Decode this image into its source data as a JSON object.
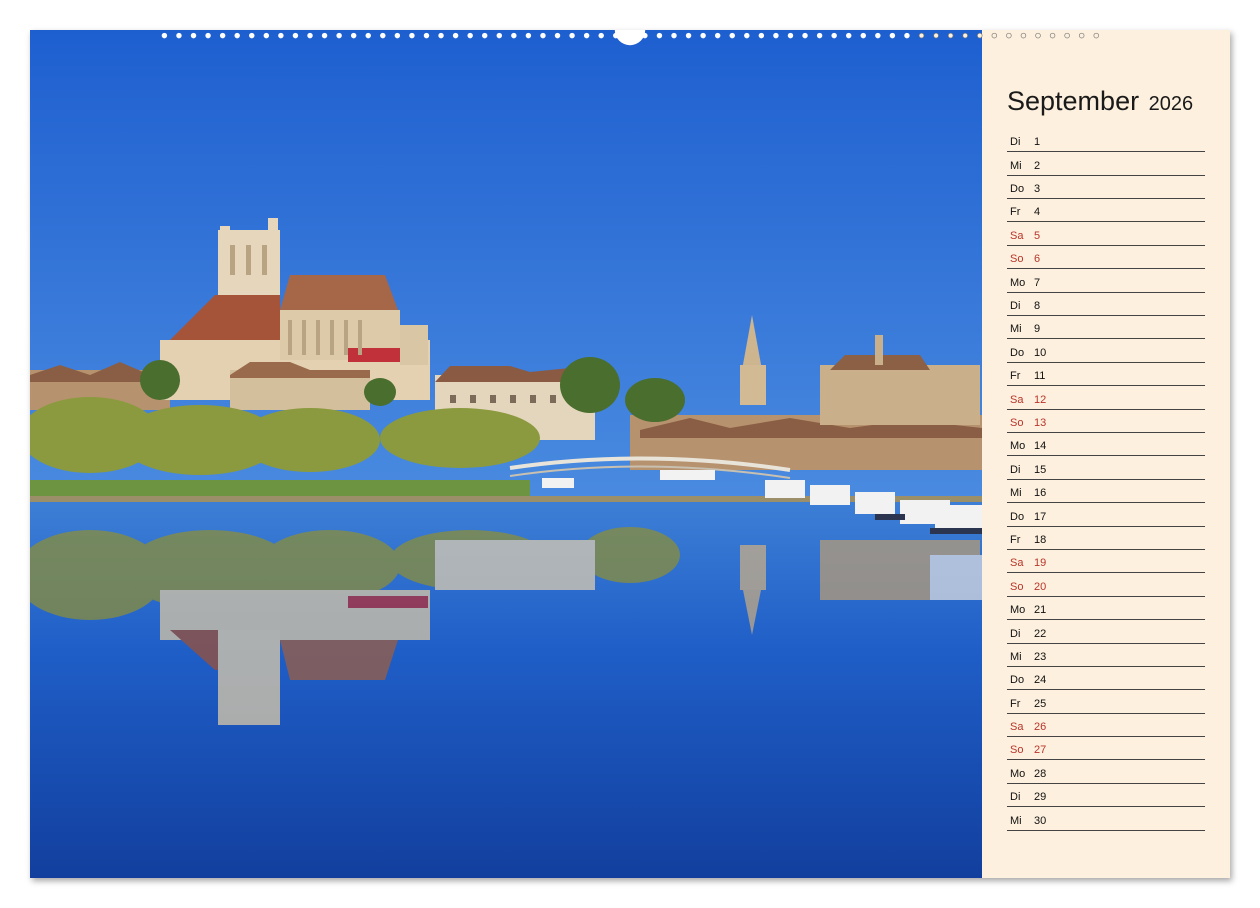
{
  "calendar": {
    "month": "September",
    "year": "2026",
    "days": [
      {
        "wd": "Di",
        "d": "1",
        "weekend": false
      },
      {
        "wd": "Mi",
        "d": "2",
        "weekend": false
      },
      {
        "wd": "Do",
        "d": "3",
        "weekend": false
      },
      {
        "wd": "Fr",
        "d": "4",
        "weekend": false
      },
      {
        "wd": "Sa",
        "d": "5",
        "weekend": true
      },
      {
        "wd": "So",
        "d": "6",
        "weekend": true
      },
      {
        "wd": "Mo",
        "d": "7",
        "weekend": false
      },
      {
        "wd": "Di",
        "d": "8",
        "weekend": false
      },
      {
        "wd": "Mi",
        "d": "9",
        "weekend": false
      },
      {
        "wd": "Do",
        "d": "10",
        "weekend": false
      },
      {
        "wd": "Fr",
        "d": "11",
        "weekend": false
      },
      {
        "wd": "Sa",
        "d": "12",
        "weekend": true
      },
      {
        "wd": "So",
        "d": "13",
        "weekend": true
      },
      {
        "wd": "Mo",
        "d": "14",
        "weekend": false
      },
      {
        "wd": "Di",
        "d": "15",
        "weekend": false
      },
      {
        "wd": "Mi",
        "d": "16",
        "weekend": false
      },
      {
        "wd": "Do",
        "d": "17",
        "weekend": false
      },
      {
        "wd": "Fr",
        "d": "18",
        "weekend": false
      },
      {
        "wd": "Sa",
        "d": "19",
        "weekend": true
      },
      {
        "wd": "So",
        "d": "20",
        "weekend": true
      },
      {
        "wd": "Mo",
        "d": "21",
        "weekend": false
      },
      {
        "wd": "Di",
        "d": "22",
        "weekend": false
      },
      {
        "wd": "Mi",
        "d": "23",
        "weekend": false
      },
      {
        "wd": "Do",
        "d": "24",
        "weekend": false
      },
      {
        "wd": "Fr",
        "d": "25",
        "weekend": false
      },
      {
        "wd": "Sa",
        "d": "26",
        "weekend": true
      },
      {
        "wd": "So",
        "d": "27",
        "weekend": true
      },
      {
        "wd": "Mo",
        "d": "28",
        "weekend": false
      },
      {
        "wd": "Di",
        "d": "29",
        "weekend": false
      },
      {
        "wd": "Mi",
        "d": "30",
        "weekend": false
      }
    ]
  },
  "colors": {
    "panel": "#fdf0de",
    "weekend": "#b8352a",
    "sky": "#2f6fd6",
    "water": "#1f56c2"
  }
}
